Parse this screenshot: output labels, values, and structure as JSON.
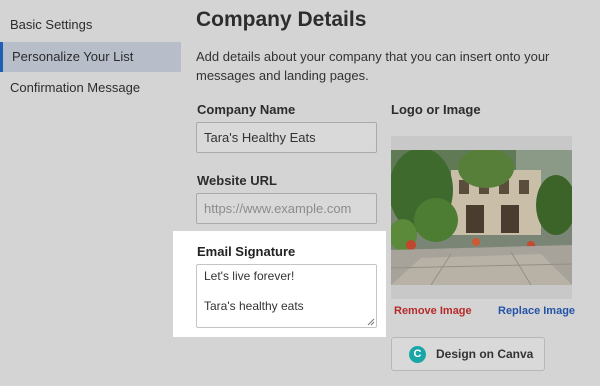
{
  "sidebar": {
    "items": [
      {
        "label": "Basic Settings",
        "active": false
      },
      {
        "label": "Personalize Your List",
        "active": true
      },
      {
        "label": "Confirmation Message",
        "active": false
      }
    ]
  },
  "main": {
    "title": "Company Details",
    "description": "Add details about your company that you can insert onto your messages and landing pages.",
    "company_name": {
      "label": "Company Name",
      "value": "Tara's Healthy Eats"
    },
    "website_url": {
      "label": "Website URL",
      "value": "",
      "placeholder": "https://www.example.com"
    },
    "email_signature": {
      "label": "Email Signature",
      "lines": [
        "Let's live forever!",
        "",
        "Tara's healthy eats"
      ]
    },
    "logo": {
      "label": "Logo or Image",
      "remove_label": "Remove Image",
      "replace_label": "Replace Image",
      "canva_label": "Design on Canva",
      "canva_icon_letter": "C"
    }
  },
  "colors": {
    "accent": "#1f5fb3",
    "remove": "#b52b2b",
    "replace": "#2553a8",
    "canva": "#1aa6a6",
    "overlay": "#d4d4d4"
  }
}
